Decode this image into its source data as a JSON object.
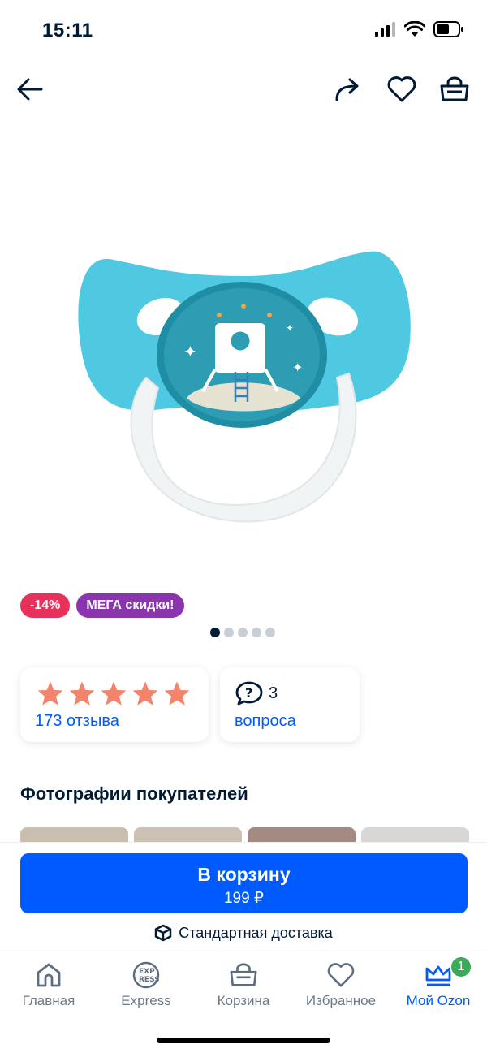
{
  "status_bar": {
    "time": "15:11"
  },
  "product": {
    "badges": {
      "discount": "-14%",
      "promo": "МЕГА скидки!"
    },
    "gallery": {
      "total": 5,
      "active_index": 0
    },
    "rating": {
      "stars": 5,
      "reviews_label": "173 отзыва"
    },
    "questions": {
      "count": "3",
      "label": "вопроса"
    }
  },
  "customer_photos": {
    "title": "Фотографии покупателей"
  },
  "cart": {
    "button_label": "В корзину",
    "price": "199 ₽",
    "delivery": "Стандартная доставка"
  },
  "tabs": [
    {
      "label": "Главная",
      "icon": "home-icon"
    },
    {
      "label": "Express",
      "icon": "express-icon"
    },
    {
      "label": "Корзина",
      "icon": "basket-icon"
    },
    {
      "label": "Избранное",
      "icon": "heart-icon"
    },
    {
      "label": "Мой Ozon",
      "icon": "crown-icon",
      "badge": "1",
      "active": true
    }
  ],
  "colors": {
    "accent": "#005bff",
    "discount": "#e8315a",
    "promo": "#8a35ad",
    "star": "#f1846a",
    "badge_green": "#3aab5a"
  }
}
